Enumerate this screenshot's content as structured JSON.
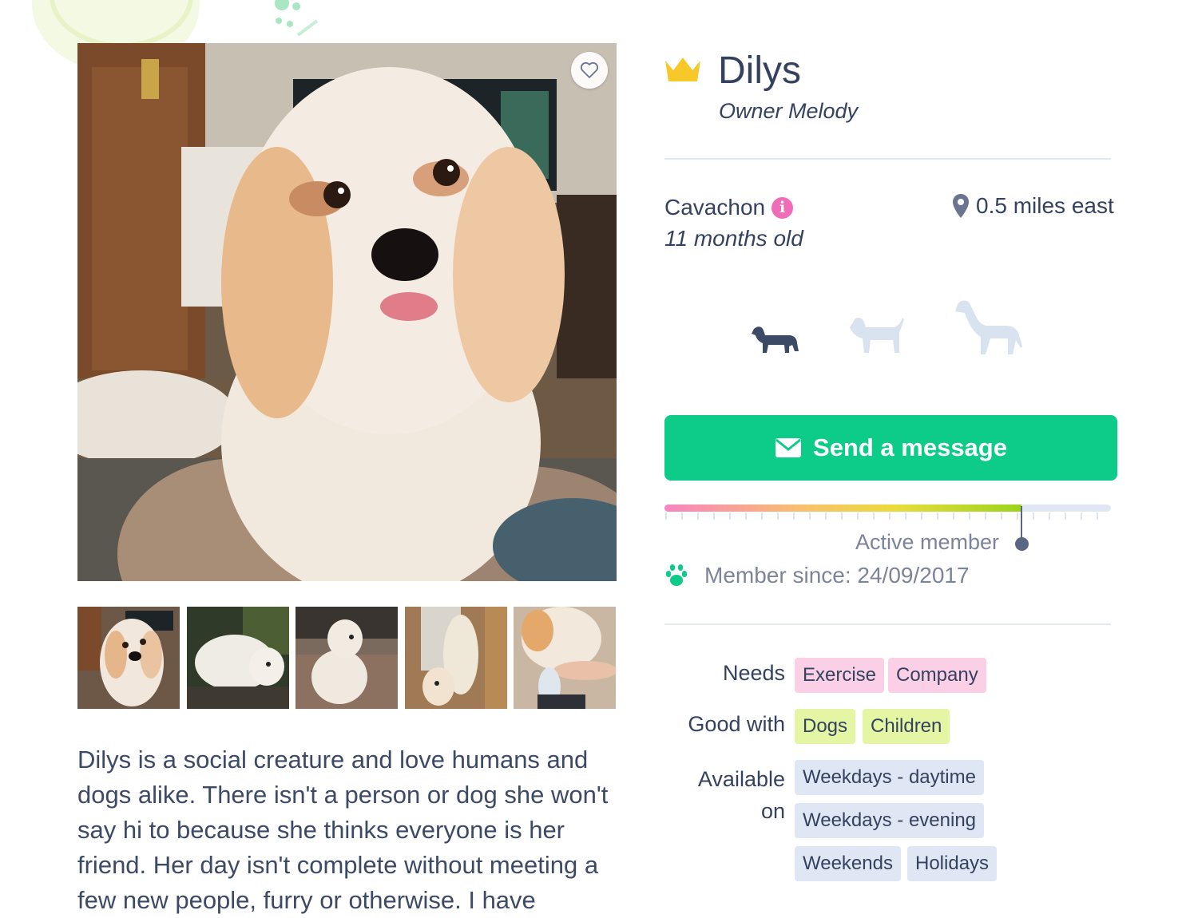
{
  "profile": {
    "name": "Dilys",
    "owner": "Owner Melody",
    "breed": "Cavachon",
    "age": "11 months old",
    "distance": "0.5 miles east",
    "description": "Dilys is a social creature and love humans and dogs alike. There isn't a person or dog she won't say hi to because she thinks everyone is her friend. Her day isn't complete without meeting a few new people, furry or otherwise. I have"
  },
  "sizes": {
    "selected": "small",
    "icons": [
      "small-dog-icon",
      "medium-dog-icon",
      "large-dog-icon"
    ]
  },
  "actions": {
    "send_message": "Send a message"
  },
  "activity": {
    "level": 0.8,
    "label": "Active member",
    "member_since": "Member since: 24/09/2017"
  },
  "tags": {
    "needs_label": "Needs",
    "needs": [
      "Exercise",
      "Company"
    ],
    "good_with_label": "Good with",
    "good_with": [
      "Dogs",
      "Children"
    ],
    "available_label": "Available on",
    "available": [
      "Weekdays - daytime",
      "Weekdays - evening",
      "Weekends",
      "Holidays"
    ]
  },
  "colors": {
    "accent": "#0dcb89",
    "crown": "#f7c82a",
    "needs_tag": "#fbd0e6",
    "good_with_tag": "#e4f5a3",
    "available_tag": "#dfe7f4"
  }
}
